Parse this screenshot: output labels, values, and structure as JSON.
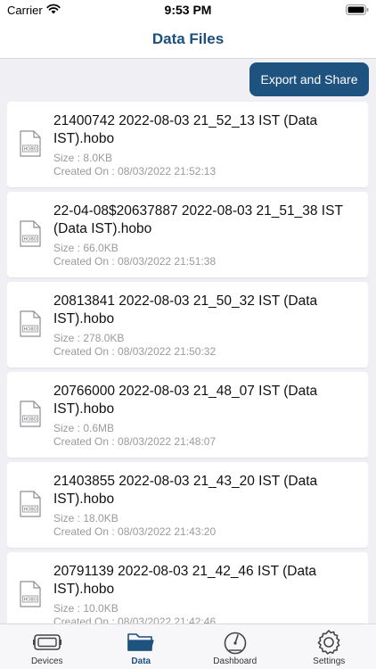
{
  "status_bar": {
    "carrier": "Carrier",
    "time": "9:53 PM"
  },
  "nav": {
    "title": "Data Files"
  },
  "toolbar": {
    "export_label": "Export and Share"
  },
  "files": [
    {
      "name": "21400742 2022-08-03 21_52_13 IST (Data IST).hobo",
      "size": "Size : 8.0KB",
      "created": "Created On : 08/03/2022 21:52:13"
    },
    {
      "name": "22-04-08$20637887 2022-08-03 21_51_38 IST (Data IST).hobo",
      "size": "Size : 66.0KB",
      "created": "Created On : 08/03/2022 21:51:38"
    },
    {
      "name": "20813841 2022-08-03 21_50_32 IST (Data IST).hobo",
      "size": "Size : 278.0KB",
      "created": "Created On : 08/03/2022 21:50:32"
    },
    {
      "name": "20766000 2022-08-03 21_48_07 IST (Data IST).hobo",
      "size": "Size : 0.6MB",
      "created": "Created On : 08/03/2022 21:48:07"
    },
    {
      "name": "21403855 2022-08-03 21_43_20 IST (Data IST).hobo",
      "size": "Size : 18.0KB",
      "created": "Created On : 08/03/2022 21:43:20"
    },
    {
      "name": "20791139 2022-08-03 21_42_46 IST (Data IST).hobo",
      "size": "Size : 10.0KB",
      "created": "Created On : 08/03/2022 21:42:46"
    }
  ],
  "file_icon": {
    "name": "hobo-file-icon",
    "label": "HOBO"
  },
  "tabs": [
    {
      "label": "Devices",
      "icon": "devices-icon"
    },
    {
      "label": "Data",
      "icon": "folder-icon",
      "active": true
    },
    {
      "label": "Dashboard",
      "icon": "gauge-icon"
    },
    {
      "label": "Settings",
      "icon": "gear-icon"
    }
  ],
  "colors": {
    "accent": "#1f537f",
    "title": "#1a4f7e",
    "muted": "#9a9aa0"
  }
}
